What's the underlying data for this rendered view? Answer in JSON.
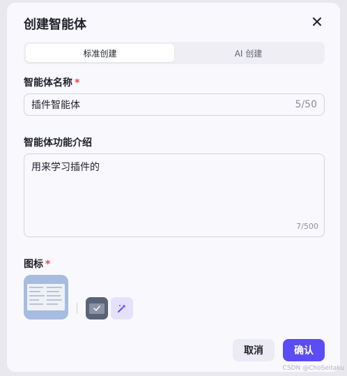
{
  "dialog": {
    "title": "创建智能体",
    "tabs": [
      {
        "label": "标准创建",
        "active": true
      },
      {
        "label": "AI 创建",
        "active": false
      }
    ],
    "name_field": {
      "label": "智能体名称",
      "required_mark": "*",
      "value": "插件智能体",
      "count": "5/50"
    },
    "desc_field": {
      "label": "智能体功能介绍",
      "value": "用来学习插件的",
      "count": "7/500"
    },
    "icon_field": {
      "label": "图标",
      "required_mark": "*"
    },
    "buttons": {
      "cancel": "取消",
      "confirm": "确认"
    }
  },
  "watermark": "CSDN @ChoSeitaku",
  "colors": {
    "primary": "#5b4cf5",
    "required": "#ef4444",
    "background": "#f9f8fc"
  }
}
